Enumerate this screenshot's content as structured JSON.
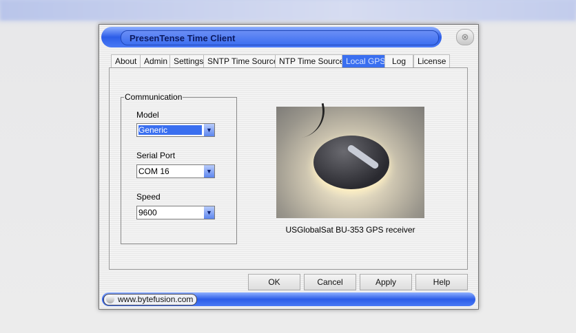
{
  "window": {
    "title": "PresenTense Time Client",
    "close_icon": "close-icon"
  },
  "tabs": [
    {
      "label": "About"
    },
    {
      "label": "Admin"
    },
    {
      "label": "Settings"
    },
    {
      "label": "SNTP Time Source"
    },
    {
      "label": "NTP Time Source"
    },
    {
      "label": "Local GPS",
      "active": true
    },
    {
      "label": "Log"
    },
    {
      "label": "License"
    }
  ],
  "communication": {
    "group_label": "Communication",
    "model": {
      "label": "Model",
      "value": "Generic"
    },
    "serial_port": {
      "label": "Serial Port",
      "value": "COM 16"
    },
    "speed": {
      "label": "Speed",
      "value": "9600"
    }
  },
  "image": {
    "caption": "USGlobalSat BU-353 GPS receiver"
  },
  "buttons": {
    "ok": "OK",
    "cancel": "Cancel",
    "apply": "Apply",
    "help": "Help"
  },
  "status": {
    "link": "www.bytefusion.com"
  }
}
